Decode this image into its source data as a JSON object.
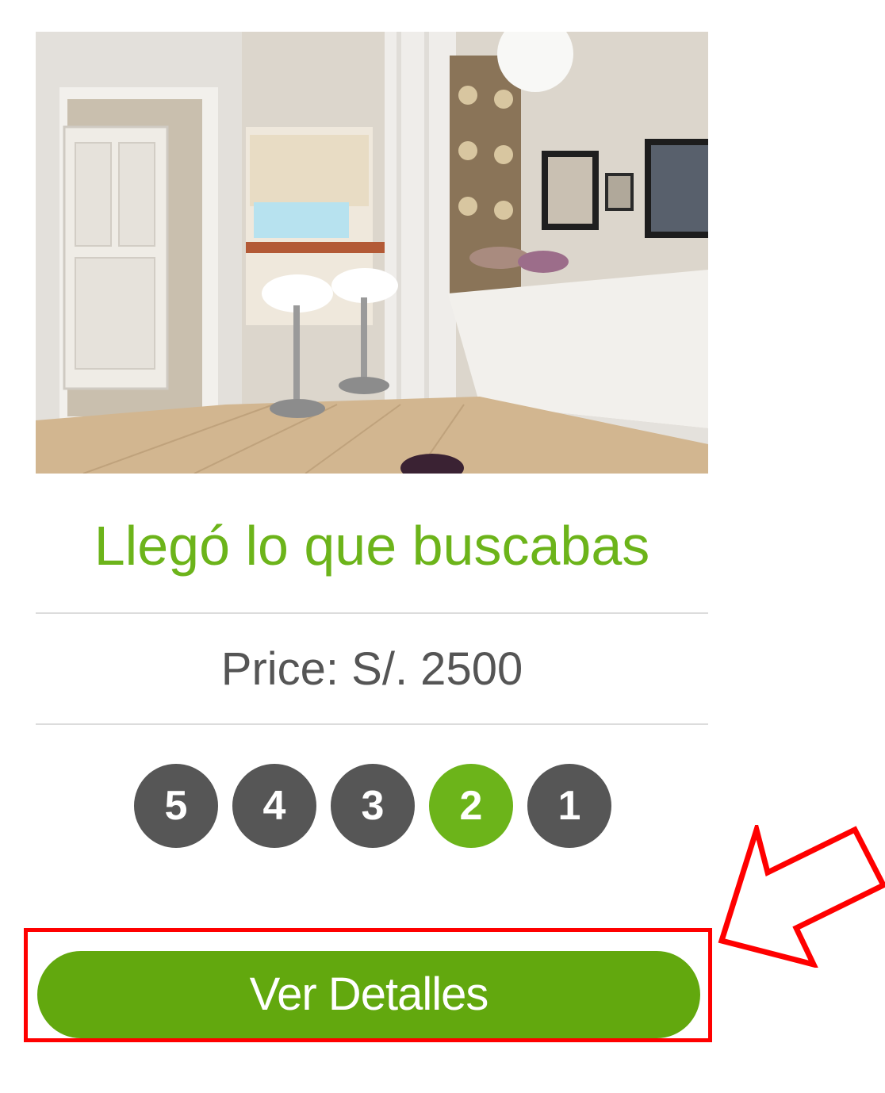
{
  "product": {
    "image_alt": "studio-apartment-photo",
    "title": "Llegó lo que buscabas",
    "price": "Price: S/. 2500"
  },
  "rating": {
    "options": [
      "5",
      "4",
      "3",
      "2",
      "1"
    ],
    "selected": "2"
  },
  "actions": {
    "details_label": "Ver Detalles"
  },
  "annotation": {
    "highlight_color": "#ff0000"
  },
  "colors": {
    "accent_green": "#6cb41a",
    "button_green": "#62a80e",
    "star_gray": "#565656",
    "price_text": "#555555"
  }
}
